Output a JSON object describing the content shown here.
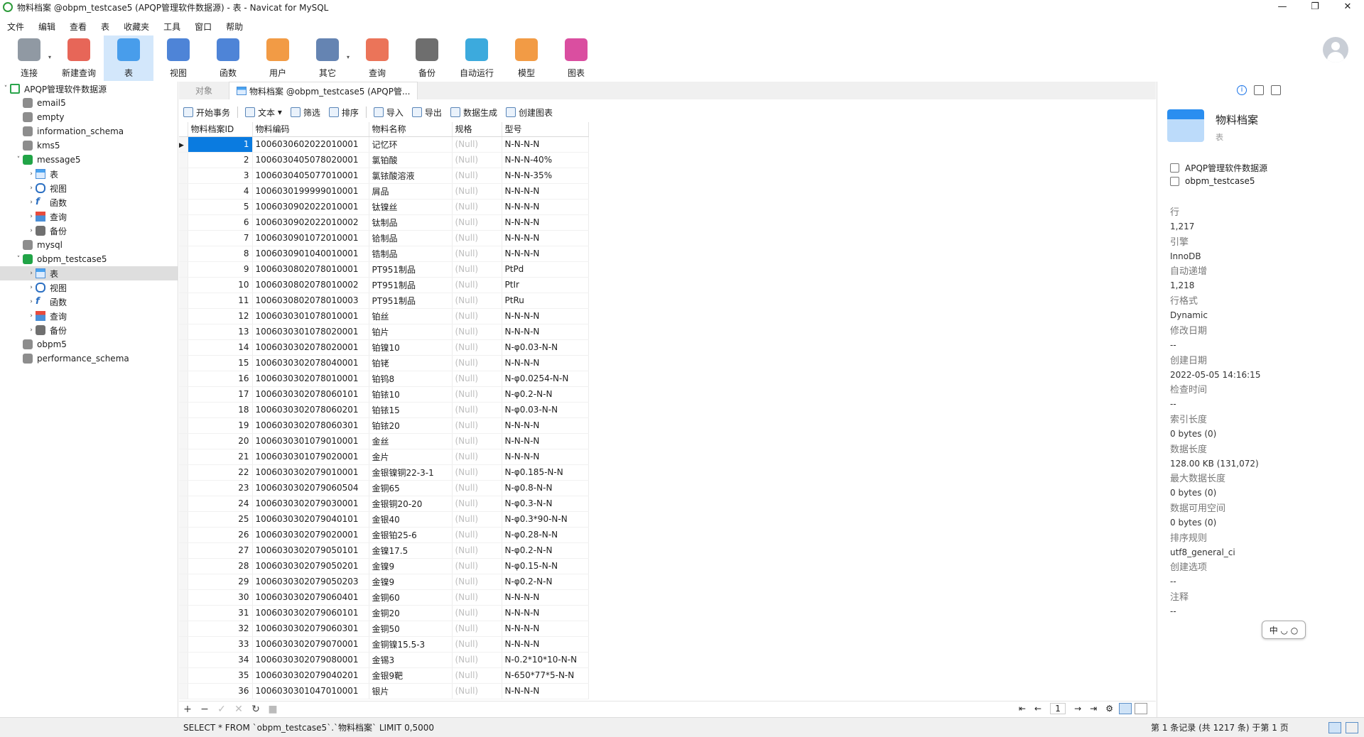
{
  "window": {
    "title": "物料档案 @obpm_testcase5 (APQP管理软件数据源) - 表 - Navicat for MySQL",
    "controls": [
      "—",
      "❐",
      "✕"
    ]
  },
  "menu": [
    "文件",
    "编辑",
    "查看",
    "表",
    "收藏夹",
    "工具",
    "窗口",
    "帮助"
  ],
  "toolbar": [
    {
      "label": "连接",
      "icon": "connection-icon"
    },
    {
      "label": "新建查询",
      "icon": "new-query-icon"
    },
    {
      "label": "表",
      "icon": "table-icon",
      "active": true
    },
    {
      "label": "视图",
      "icon": "view-icon"
    },
    {
      "label": "函数",
      "icon": "function-icon"
    },
    {
      "label": "用户",
      "icon": "user-icon"
    },
    {
      "label": "其它",
      "icon": "tools-icon"
    },
    {
      "label": "查询",
      "icon": "query-icon"
    },
    {
      "label": "备份",
      "icon": "backup-icon"
    },
    {
      "label": "自动运行",
      "icon": "robot-icon"
    },
    {
      "label": "模型",
      "icon": "model-icon"
    },
    {
      "label": "图表",
      "icon": "chart-icon"
    }
  ],
  "tree": [
    {
      "label": "APQP管理软件数据源",
      "level": 0,
      "type": "conn",
      "exp": "˅"
    },
    {
      "label": "email5",
      "level": 1,
      "type": "db"
    },
    {
      "label": "empty",
      "level": 1,
      "type": "db"
    },
    {
      "label": "information_schema",
      "level": 1,
      "type": "db"
    },
    {
      "label": "kms5",
      "level": 1,
      "type": "db"
    },
    {
      "label": "message5",
      "level": 1,
      "type": "dbopen",
      "exp": "˅"
    },
    {
      "label": "表",
      "level": 2,
      "type": "table",
      "exp": "›"
    },
    {
      "label": "视图",
      "level": 2,
      "type": "view",
      "exp": "›"
    },
    {
      "label": "函数",
      "level": 2,
      "type": "func",
      "exp": "›"
    },
    {
      "label": "查询",
      "level": 2,
      "type": "query",
      "exp": "›"
    },
    {
      "label": "备份",
      "level": 2,
      "type": "backup",
      "exp": "›"
    },
    {
      "label": "mysql",
      "level": 1,
      "type": "db"
    },
    {
      "label": "obpm_testcase5",
      "level": 1,
      "type": "dbopen",
      "exp": "˅"
    },
    {
      "label": "表",
      "level": 2,
      "type": "table",
      "exp": "›",
      "selected": true
    },
    {
      "label": "视图",
      "level": 2,
      "type": "view",
      "exp": "›"
    },
    {
      "label": "函数",
      "level": 2,
      "type": "func",
      "exp": "›"
    },
    {
      "label": "查询",
      "level": 2,
      "type": "query",
      "exp": "›"
    },
    {
      "label": "备份",
      "level": 2,
      "type": "backup",
      "exp": "›"
    },
    {
      "label": "obpm5",
      "level": 1,
      "type": "db"
    },
    {
      "label": "performance_schema",
      "level": 1,
      "type": "db"
    }
  ],
  "tabs": {
    "objects": "对象",
    "active": "物料档案 @obpm_testcase5 (APQP管..."
  },
  "subtoolbar": [
    "开始事务",
    "文本",
    "筛选",
    "排序",
    "导入",
    "导出",
    "数据生成",
    "创建图表"
  ],
  "grid": {
    "columns": [
      "物料档案ID",
      "物料编码",
      "物料名称",
      "规格",
      "型号"
    ],
    "null_text": "(Null)",
    "rows": [
      [
        "1",
        "1006030602022010001",
        "记忆环",
        "N-N-N-N"
      ],
      [
        "2",
        "1006030405078020001",
        "氯铂酸",
        "N-N-N-40%"
      ],
      [
        "3",
        "1006030405077010001",
        "氯铱酸溶液",
        "N-N-N-35%"
      ],
      [
        "4",
        "1006030199999010001",
        "屑品",
        "N-N-N-N"
      ],
      [
        "5",
        "1006030902022010001",
        "钛镍丝",
        "N-N-N-N"
      ],
      [
        "6",
        "1006030902022010002",
        "钛制品",
        "N-N-N-N"
      ],
      [
        "7",
        "1006030901072010001",
        "铪制品",
        "N-N-N-N"
      ],
      [
        "8",
        "1006030901040010001",
        "锆制品",
        "N-N-N-N"
      ],
      [
        "9",
        "1006030802078010001",
        "PT951制品",
        "PtPd"
      ],
      [
        "10",
        "1006030802078010002",
        "PT951制品",
        "PtIr"
      ],
      [
        "11",
        "1006030802078010003",
        "PT951制品",
        "PtRu"
      ],
      [
        "12",
        "1006030301078010001",
        "铂丝",
        "N-N-N-N"
      ],
      [
        "13",
        "1006030301078020001",
        "铂片",
        "N-N-N-N"
      ],
      [
        "14",
        "1006030302078020001",
        "铂镍10",
        "N-φ0.03-N-N"
      ],
      [
        "15",
        "1006030302078040001",
        "铂铑",
        "N-N-N-N"
      ],
      [
        "16",
        "1006030302078010001",
        "铂钨8",
        "N-φ0.0254-N-N"
      ],
      [
        "17",
        "1006030302078060101",
        "铂铱10",
        "N-φ0.2-N-N"
      ],
      [
        "18",
        "1006030302078060201",
        "铂铱15",
        "N-φ0.03-N-N"
      ],
      [
        "19",
        "1006030302078060301",
        "铂铱20",
        "N-N-N-N"
      ],
      [
        "20",
        "1006030301079010001",
        "金丝",
        "N-N-N-N"
      ],
      [
        "21",
        "1006030301079020001",
        "金片",
        "N-N-N-N"
      ],
      [
        "22",
        "1006030302079010001",
        "金银镍铜22-3-1",
        "N-φ0.185-N-N"
      ],
      [
        "23",
        "1006030302079060504",
        "金铜65",
        "N-φ0.8-N-N"
      ],
      [
        "24",
        "1006030302079030001",
        "金银铜20-20",
        "N-φ0.3-N-N"
      ],
      [
        "25",
        "1006030302079040101",
        "金银40",
        "N-φ0.3*90-N-N"
      ],
      [
        "26",
        "1006030302079020001",
        "金银铂25-6",
        "N-φ0.28-N-N"
      ],
      [
        "27",
        "1006030302079050101",
        "金镍17.5",
        "N-φ0.2-N-N"
      ],
      [
        "28",
        "1006030302079050201",
        "金镍9",
        "N-φ0.15-N-N"
      ],
      [
        "29",
        "1006030302079050203",
        "金镍9",
        "N-φ0.2-N-N"
      ],
      [
        "30",
        "1006030302079060401",
        "金铜60",
        "N-N-N-N"
      ],
      [
        "31",
        "1006030302079060101",
        "金铜20",
        "N-N-N-N"
      ],
      [
        "32",
        "1006030302079060301",
        "金铜50",
        "N-N-N-N"
      ],
      [
        "33",
        "1006030302079070001",
        "金铜镍15.5-3",
        "N-N-N-N"
      ],
      [
        "34",
        "1006030302079080001",
        "金锡3",
        "N-0.2*10*10-N-N"
      ],
      [
        "35",
        "1006030302079040201",
        "金银9靶",
        "N-650*77*5-N-N"
      ],
      [
        "36",
        "1006030301047010001",
        "银片",
        "N-N-N-N"
      ]
    ]
  },
  "gridbar": {
    "buttons": [
      "+",
      "−",
      "✓",
      "✕",
      "↻",
      "■"
    ],
    "page": "1",
    "nav": [
      "⇤",
      "←",
      "→",
      "⇥",
      "⚙"
    ]
  },
  "panel": {
    "name": "物料档案",
    "type": "表",
    "source": "APQP管理软件数据源",
    "database": "obpm_testcase5",
    "props": [
      {
        "label": "行",
        "value": "1,217"
      },
      {
        "label": "引擎",
        "value": "InnoDB"
      },
      {
        "label": "自动递增",
        "value": "1,218"
      },
      {
        "label": "行格式",
        "value": "Dynamic"
      },
      {
        "label": "修改日期",
        "value": "--"
      },
      {
        "label": "创建日期",
        "value": "2022-05-05 14:16:15"
      },
      {
        "label": "检查时间",
        "value": "--"
      },
      {
        "label": "索引长度",
        "value": "0 bytes (0)"
      },
      {
        "label": "数据长度",
        "value": "128.00 KB (131,072)"
      },
      {
        "label": "最大数据长度",
        "value": "0 bytes (0)"
      },
      {
        "label": "数据可用空间",
        "value": "0 bytes (0)"
      },
      {
        "label": "排序规则",
        "value": "utf8_general_ci"
      },
      {
        "label": "创建选项",
        "value": "--"
      },
      {
        "label": "注释",
        "value": "--"
      }
    ]
  },
  "ime": "中 ◡ ○",
  "status": {
    "sql": "SELECT * FROM `obpm_testcase5`.`物料档案` LIMIT 0,5000",
    "records": "第 1 条记录 (共 1217 条) 于第 1 页"
  },
  "colors": {
    "accent": "#0a7be0",
    "active_tool": "#d3e7fb",
    "null_text": "#bdbdbd"
  }
}
